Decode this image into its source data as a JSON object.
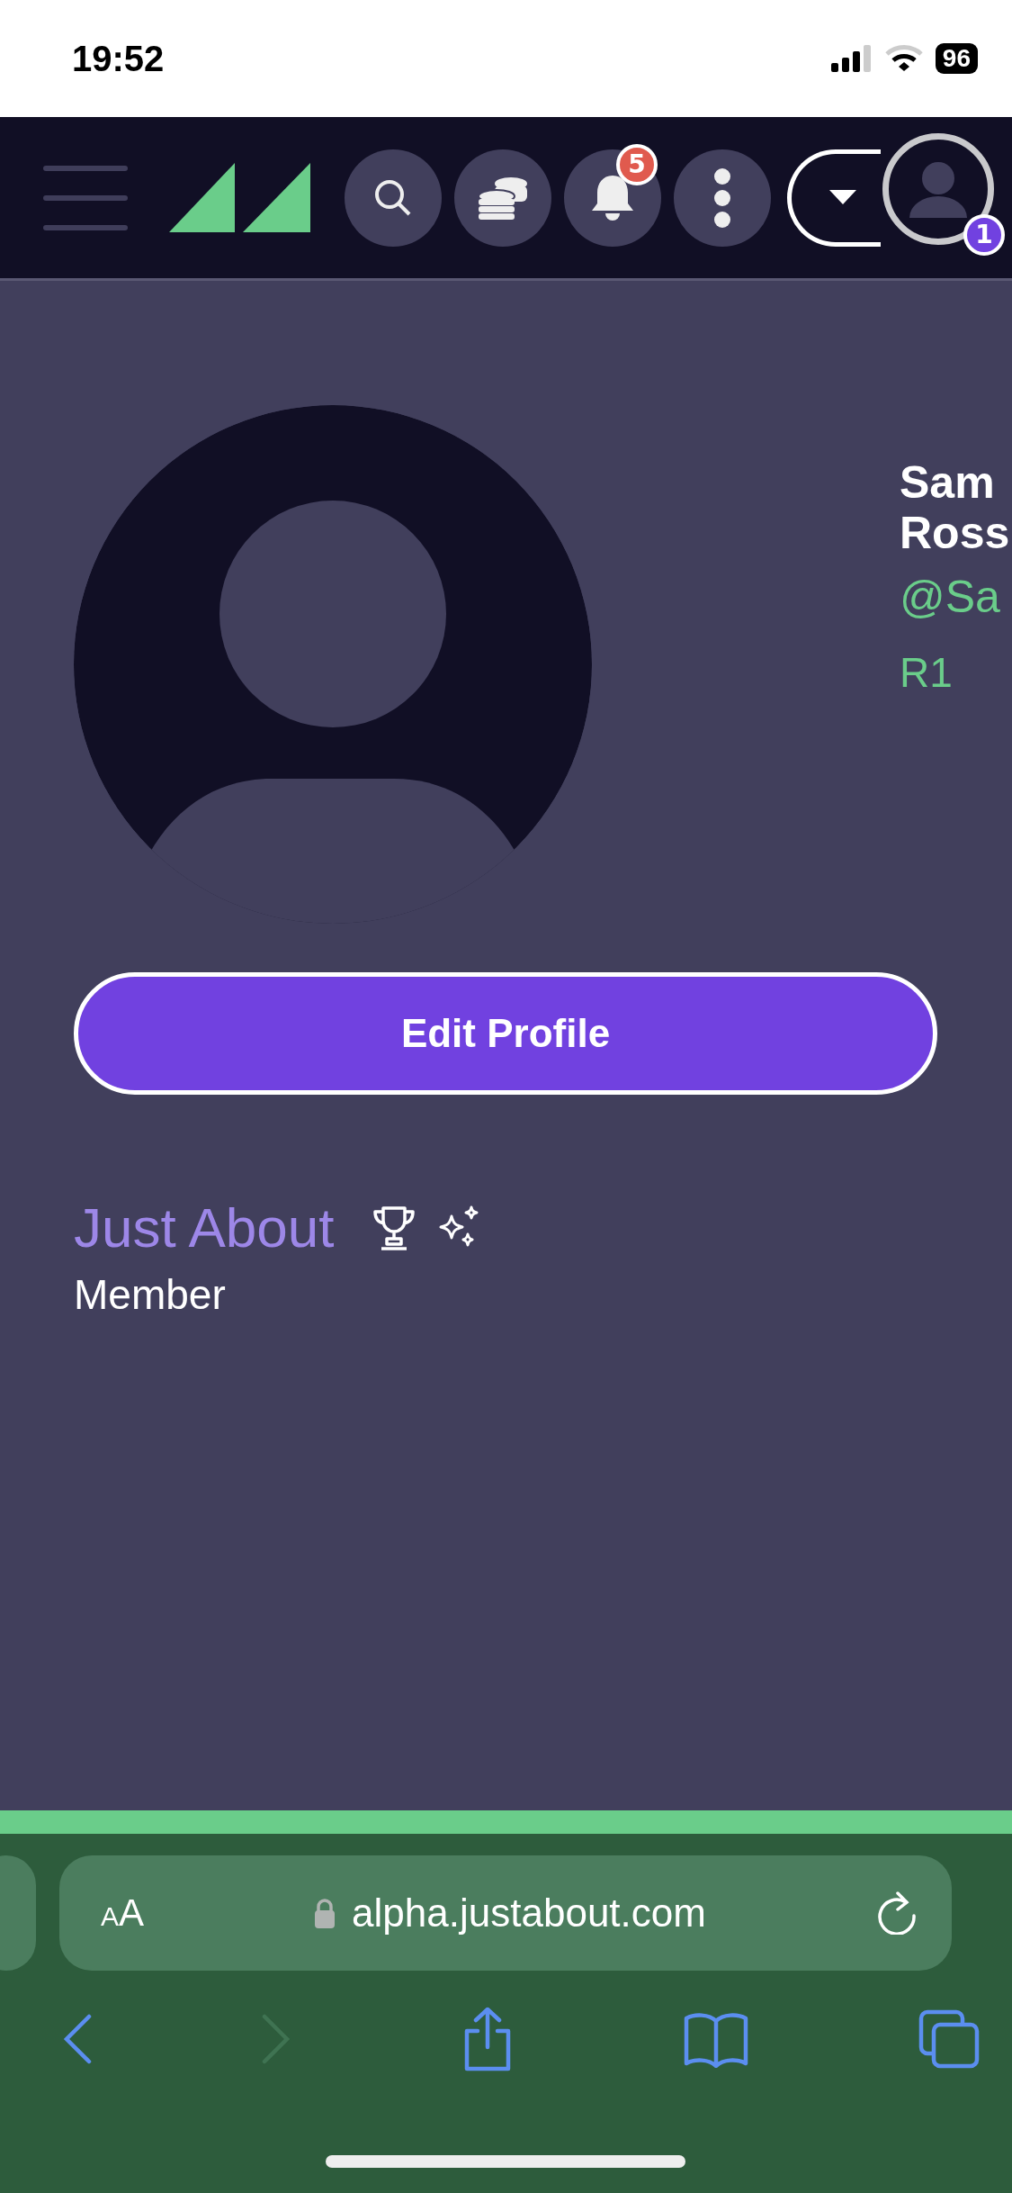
{
  "status_bar": {
    "time": "19:52",
    "battery": "96"
  },
  "header": {
    "notification_count": "5",
    "account_badge": "1"
  },
  "profile": {
    "name_lines": [
      "Sam",
      "Ross"
    ],
    "handle": "@Sa",
    "rank": "R1",
    "edit_button": "Edit Profile",
    "community": "Just About",
    "role": "Member"
  },
  "browser": {
    "text_size": [
      "A",
      "A"
    ],
    "url": "alpha.justabout.com",
    "nav": [
      {
        "kind": "back",
        "disabled": false
      },
      {
        "kind": "forward",
        "disabled": true
      }
    ]
  }
}
